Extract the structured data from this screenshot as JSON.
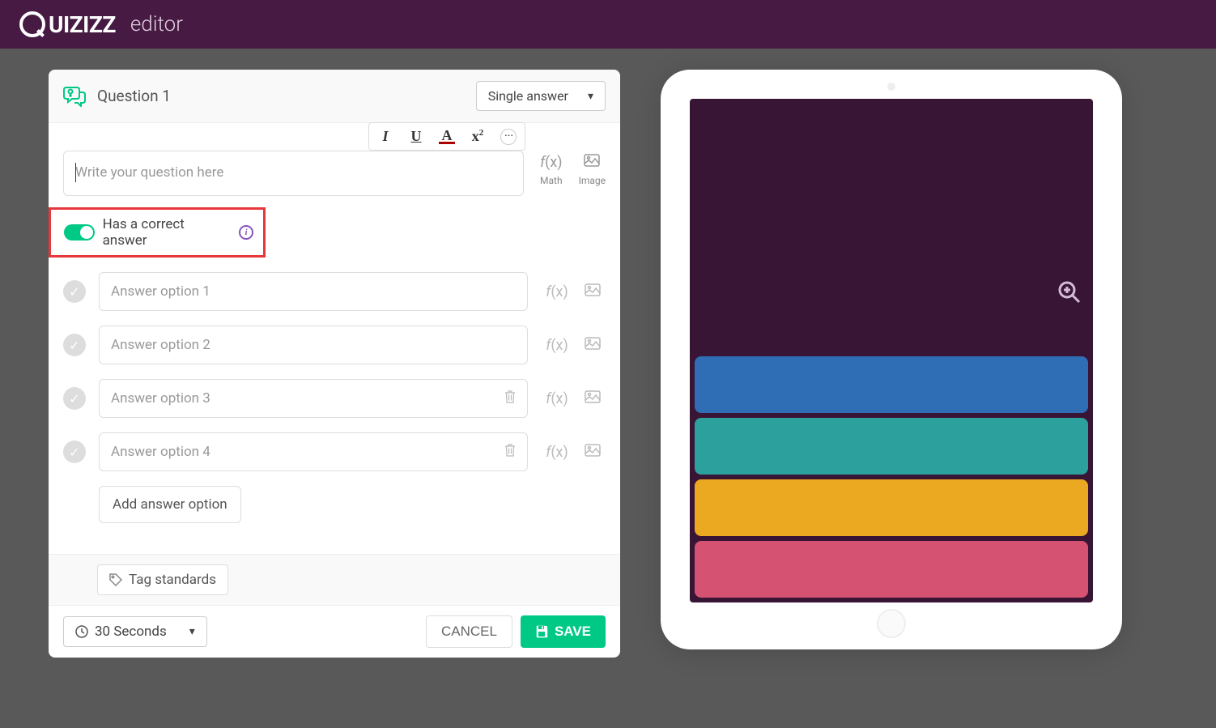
{
  "header": {
    "logo_text": "UIZIZZ",
    "editor_label": "editor"
  },
  "card": {
    "question_number": "Question 1",
    "answer_type": "Single answer",
    "question_placeholder": "Write your question here",
    "helpers": {
      "math": "Math",
      "image": "Image"
    },
    "correct_toggle_label": "Has a correct answer",
    "answers": [
      {
        "placeholder": "Answer option 1",
        "deletable": false
      },
      {
        "placeholder": "Answer option 2",
        "deletable": false
      },
      {
        "placeholder": "Answer option 3",
        "deletable": true
      },
      {
        "placeholder": "Answer option 4",
        "deletable": true
      }
    ],
    "add_answer_label": "Add answer option",
    "tag_label": "Tag standards",
    "time_label": "30 Seconds",
    "cancel_label": "CANCEL",
    "save_label": "SAVE"
  },
  "preview": {
    "colors": [
      "#2F6DB5",
      "#2CA09D",
      "#EBA921",
      "#D65273"
    ]
  }
}
